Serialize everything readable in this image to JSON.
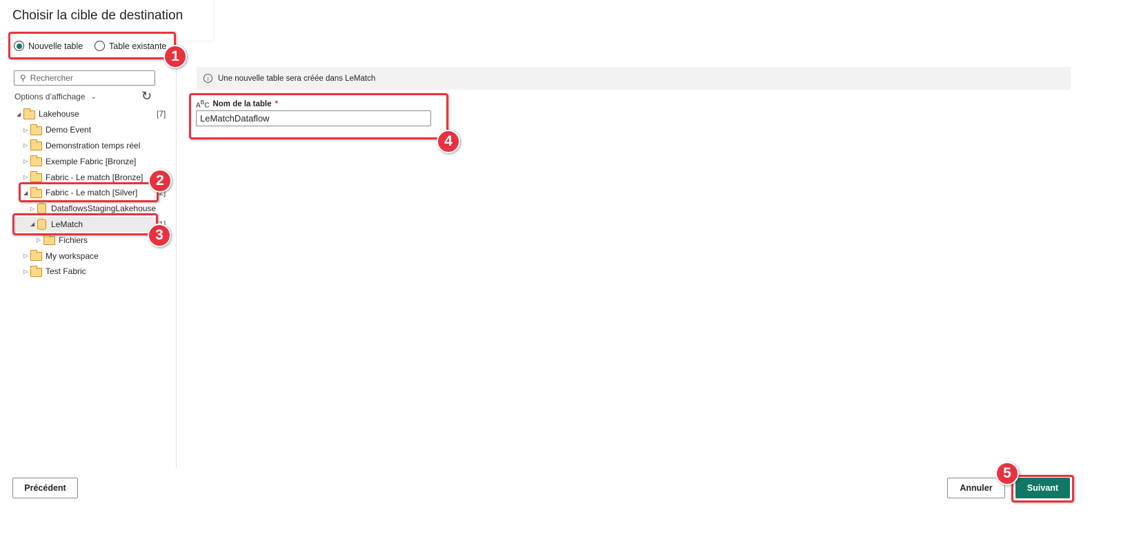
{
  "title": "Choisir la cible de destination",
  "mode": {
    "options": [
      "Nouvelle table",
      "Table existante"
    ],
    "selected": "Nouvelle table"
  },
  "search": {
    "placeholder": "Rechercher"
  },
  "display_options": "Options d’affichage",
  "tree": [
    {
      "label": "Lakehouse",
      "count": "[7]",
      "level": 0,
      "expanded": true,
      "icon": "folder-icon"
    },
    {
      "label": "Demo Event",
      "level": 1,
      "icon": "folder-icon"
    },
    {
      "label": "Demonstration temps réel",
      "level": 1,
      "icon": "folder-icon"
    },
    {
      "label": "Exemple Fabric [Bronze]",
      "level": 1,
      "icon": "folder-icon"
    },
    {
      "label": "Fabric - Le match [Bronze]",
      "level": 1,
      "icon": "folder-icon"
    },
    {
      "label": "Fabric - Le match [Silver]",
      "count": "[2]",
      "level": 1,
      "expanded": true,
      "icon": "folder-icon"
    },
    {
      "label": "DataflowsStagingLakehouse",
      "level": 2,
      "icon": "database-icon"
    },
    {
      "label": "LeMatch",
      "count": "[1]",
      "level": 2,
      "expanded": true,
      "selected": true,
      "icon": "database-icon"
    },
    {
      "label": "Fichiers",
      "count": "[1]",
      "level": 3,
      "icon": "folder-icon"
    },
    {
      "label": "My workspace",
      "level": 1,
      "icon": "folder-icon"
    },
    {
      "label": "Test Fabric",
      "level": 1,
      "icon": "folder-icon"
    }
  ],
  "info": "Une nouvelle table sera créée dans LeMatch",
  "table_name": {
    "label": "Nom de la table",
    "required": "*",
    "value": "LeMatchDataflow"
  },
  "buttons": {
    "previous": "Précédent",
    "cancel": "Annuler",
    "next": "Suivant"
  },
  "annotations": [
    "1",
    "2",
    "3",
    "4",
    "5"
  ],
  "colors": {
    "accent": "#117865",
    "annotation": "#e8323f"
  }
}
